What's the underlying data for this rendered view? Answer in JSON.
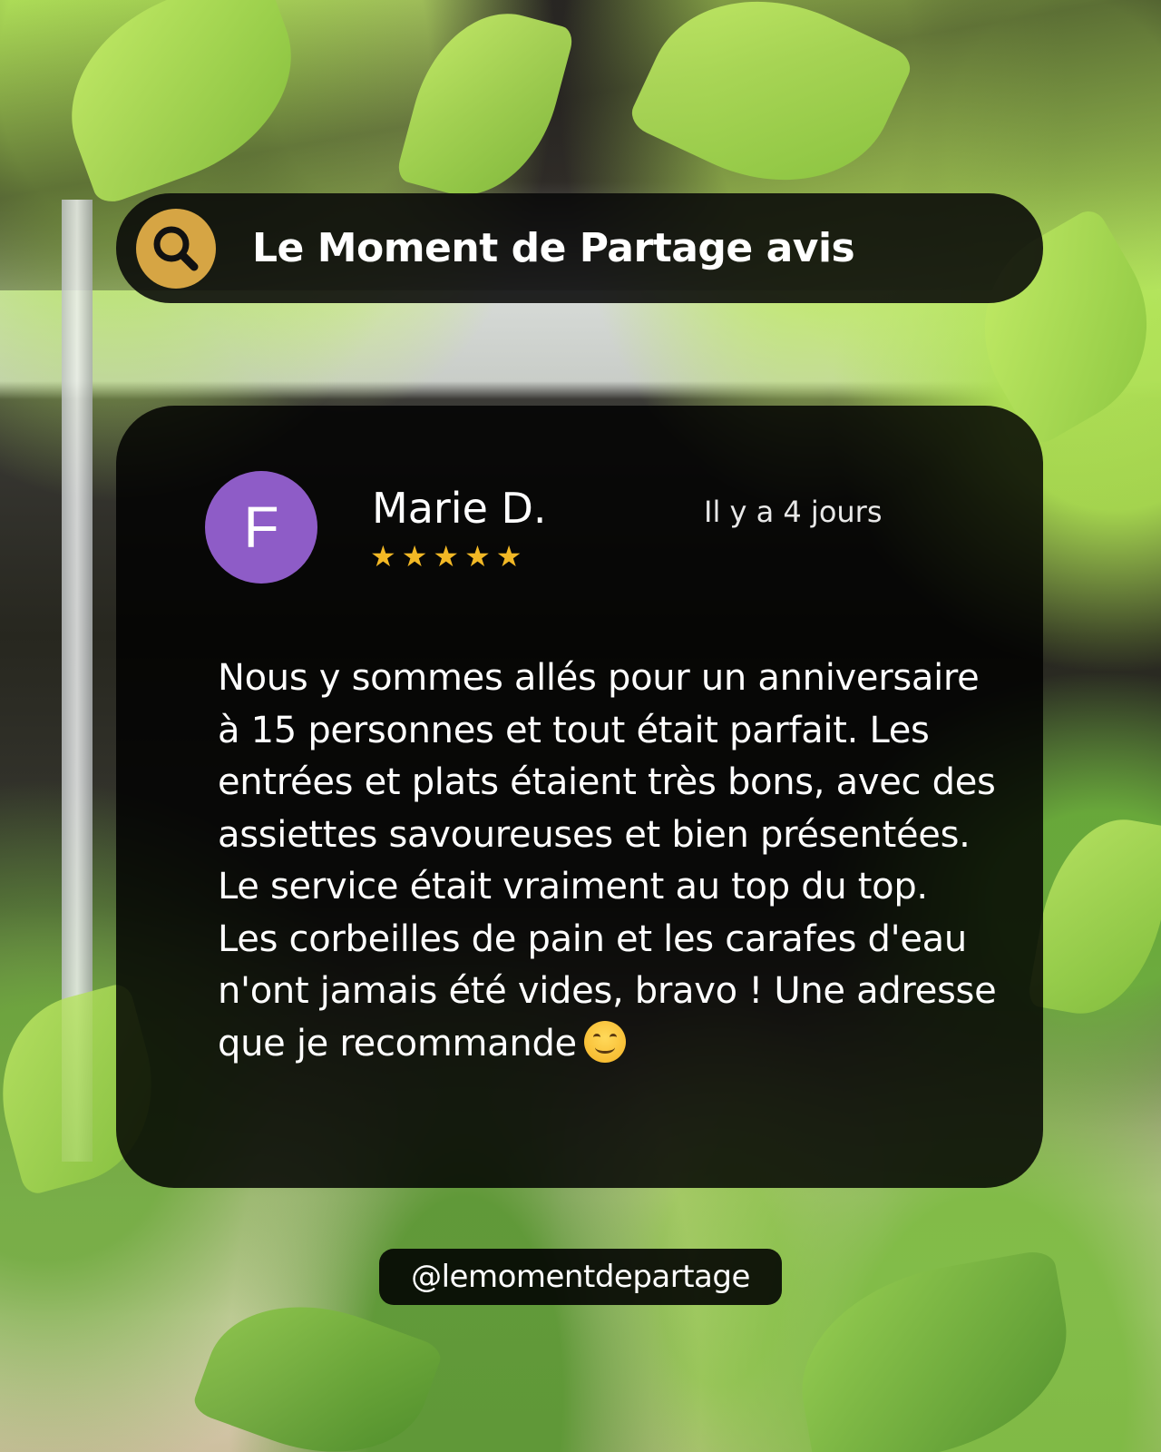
{
  "header": {
    "title": "Le Moment de Partage avis",
    "icon": "search-icon",
    "badge_color": "#d6a544"
  },
  "review": {
    "avatar_initial": "F",
    "avatar_color": "#8e5cc7",
    "reviewer_name": "Marie D.",
    "date": "Il y a 4 jours",
    "rating": 5,
    "rating_max": 5,
    "star_glyph": "★",
    "star_color": "#f2b825",
    "text": "Nous y sommes allés pour un anniversaire à 15 personnes et tout était parfait. Les entrées et plats étaient très bons, avec des assiettes savoureuses et bien présentées. Le service était vraiment au top du top. Les corbeilles de pain et les carafes d'eau n'ont jamais été vides, bravo ! Une adresse que je recommande",
    "emoji": "smiling-face-icon"
  },
  "footer": {
    "handle": "@lemomentdepartage"
  }
}
